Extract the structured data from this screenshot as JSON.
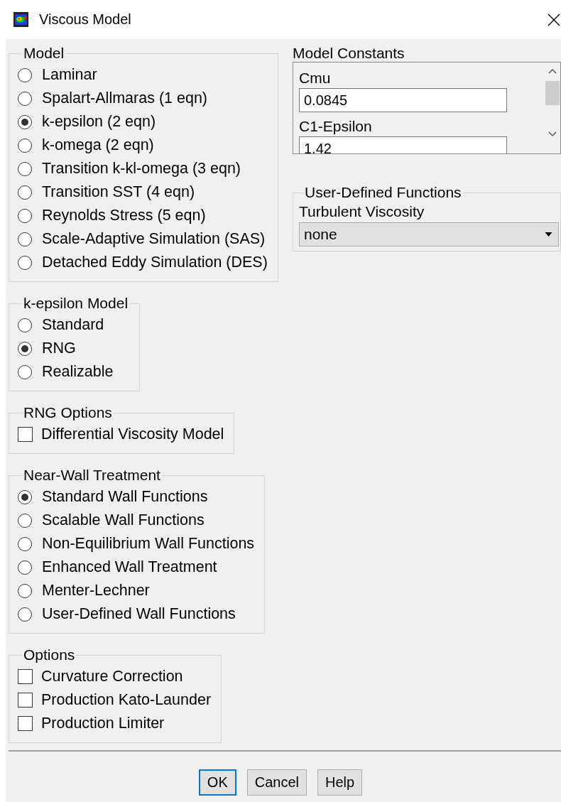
{
  "window": {
    "title": "Viscous Model"
  },
  "groups": [
    {
      "title": "Model",
      "kind": "radio",
      "options": [
        {
          "label": "Laminar",
          "selected": false
        },
        {
          "label": "Spalart-Allmaras (1 eqn)",
          "selected": false
        },
        {
          "label": "k-epsilon (2 eqn)",
          "selected": true
        },
        {
          "label": "k-omega (2 eqn)",
          "selected": false
        },
        {
          "label": "Transition k-kl-omega (3 eqn)",
          "selected": false
        },
        {
          "label": "Transition SST (4 eqn)",
          "selected": false
        },
        {
          "label": "Reynolds Stress (5 eqn)",
          "selected": false
        },
        {
          "label": "Scale-Adaptive Simulation (SAS)",
          "selected": false
        },
        {
          "label": "Detached Eddy Simulation (DES)",
          "selected": false
        }
      ]
    },
    {
      "title": "k-epsilon Model",
      "kind": "radio",
      "options": [
        {
          "label": "Standard",
          "selected": false
        },
        {
          "label": "RNG",
          "selected": true
        },
        {
          "label": "Realizable",
          "selected": false
        }
      ]
    },
    {
      "title": "RNG Options",
      "kind": "checkbox",
      "options": [
        {
          "label": "Differential Viscosity Model",
          "checked": false
        }
      ]
    },
    {
      "title": "Near-Wall Treatment",
      "kind": "radio",
      "options": [
        {
          "label": "Standard Wall Functions",
          "selected": true
        },
        {
          "label": "Scalable Wall Functions",
          "selected": false
        },
        {
          "label": "Non-Equilibrium Wall Functions",
          "selected": false
        },
        {
          "label": "Enhanced Wall Treatment",
          "selected": false
        },
        {
          "label": "Menter-Lechner",
          "selected": false
        },
        {
          "label": "User-Defined Wall Functions",
          "selected": false
        }
      ]
    },
    {
      "title": "Options",
      "kind": "checkbox",
      "options": [
        {
          "label": "Curvature Correction",
          "checked": false
        },
        {
          "label": "Production Kato-Launder",
          "checked": false
        },
        {
          "label": "Production Limiter",
          "checked": false
        }
      ]
    }
  ],
  "model_constants": {
    "title": "Model Constants",
    "constants": [
      {
        "label": "Cmu",
        "value": "0.0845"
      },
      {
        "label": "C1-Epsilon",
        "value": "1.42"
      }
    ]
  },
  "udf": {
    "title": "User-Defined Functions",
    "label": "Turbulent Viscosity",
    "value": "none"
  },
  "buttons": [
    {
      "label": "OK",
      "default": true
    },
    {
      "label": "Cancel",
      "default": false
    },
    {
      "label": "Help",
      "default": false
    }
  ]
}
